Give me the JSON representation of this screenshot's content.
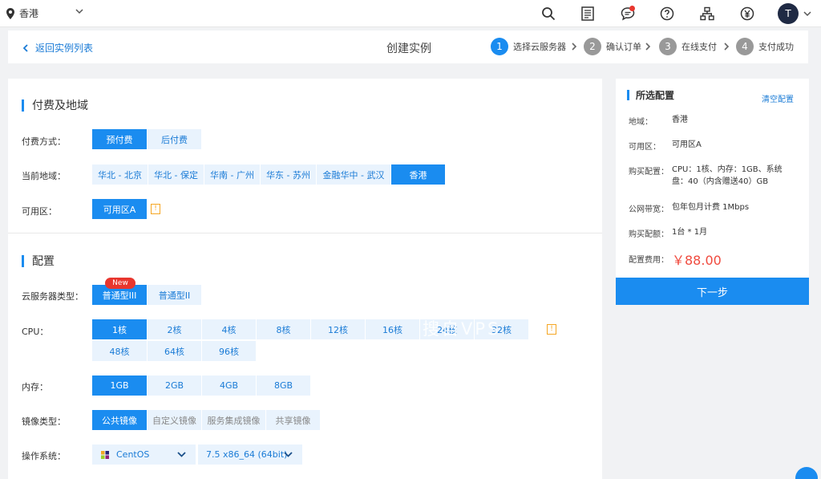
{
  "topbar": {
    "region": "香港",
    "avatar_letter": "T",
    "icons": [
      "search-icon",
      "document-icon",
      "message-icon",
      "help-icon",
      "network-icon",
      "yen-icon"
    ]
  },
  "breadcrumb": {
    "back_label": "返回实例列表",
    "page_title": "创建实例",
    "steps": [
      {
        "num": "1",
        "label": "选择云服务器"
      },
      {
        "num": "2",
        "label": "确认订单"
      },
      {
        "num": "3",
        "label": "在线支付"
      },
      {
        "num": "4",
        "label": "支付成功"
      }
    ]
  },
  "billing_section": {
    "title": "付费及地域",
    "pay_label": "付费方式：",
    "pay_options": [
      "预付费",
      "后付费"
    ],
    "region_label": "当前地域：",
    "region_options": [
      "华北 - 北京",
      "华北 - 保定",
      "华南 - 广州",
      "华东 - 苏州",
      "金融华中 - 武汉",
      "香港"
    ],
    "zone_label": "可用区：",
    "zone_options": [
      "可用区A"
    ],
    "warn_mark": "!"
  },
  "config_section": {
    "title": "配置",
    "type_label": "云服务器类型：",
    "new_badge": "New",
    "type_options": [
      "普通型III",
      "普通型II"
    ],
    "cpu_label": "CPU：",
    "cpu_options": [
      "1核",
      "2核",
      "4核",
      "8核",
      "12核",
      "16核",
      "24核",
      "32核",
      "48核",
      "64核",
      "96核"
    ],
    "mem_label": "内存：",
    "mem_options": [
      "1GB",
      "2GB",
      "4GB",
      "8GB"
    ],
    "image_label": "镜像类型：",
    "image_options": [
      "公共镜像",
      "自定义镜像",
      "服务集成镜像",
      "共享镜像"
    ],
    "os_label": "操作系统：",
    "os_value": "CentOS",
    "os_version": "7.5 x86_64 (64bit)"
  },
  "summary": {
    "title": "所选配置",
    "clear_label": "清空配置",
    "rows": [
      {
        "label": "地域：",
        "value": "香港"
      },
      {
        "label": "可用区：",
        "value": "可用区A"
      },
      {
        "label": "购买配置：",
        "value": "CPU：1核、内存：1GB、系统盘：40（内含赠送40）GB"
      },
      {
        "label": "公网带宽：",
        "value": "包年包月计费 1Mbps"
      },
      {
        "label": "购买配额：",
        "value": "1台 * 1月"
      },
      {
        "label": "配置费用：",
        "value": ""
      }
    ],
    "price": "￥88.00",
    "next_label": "下一步"
  },
  "watermark": "搜自VPS"
}
